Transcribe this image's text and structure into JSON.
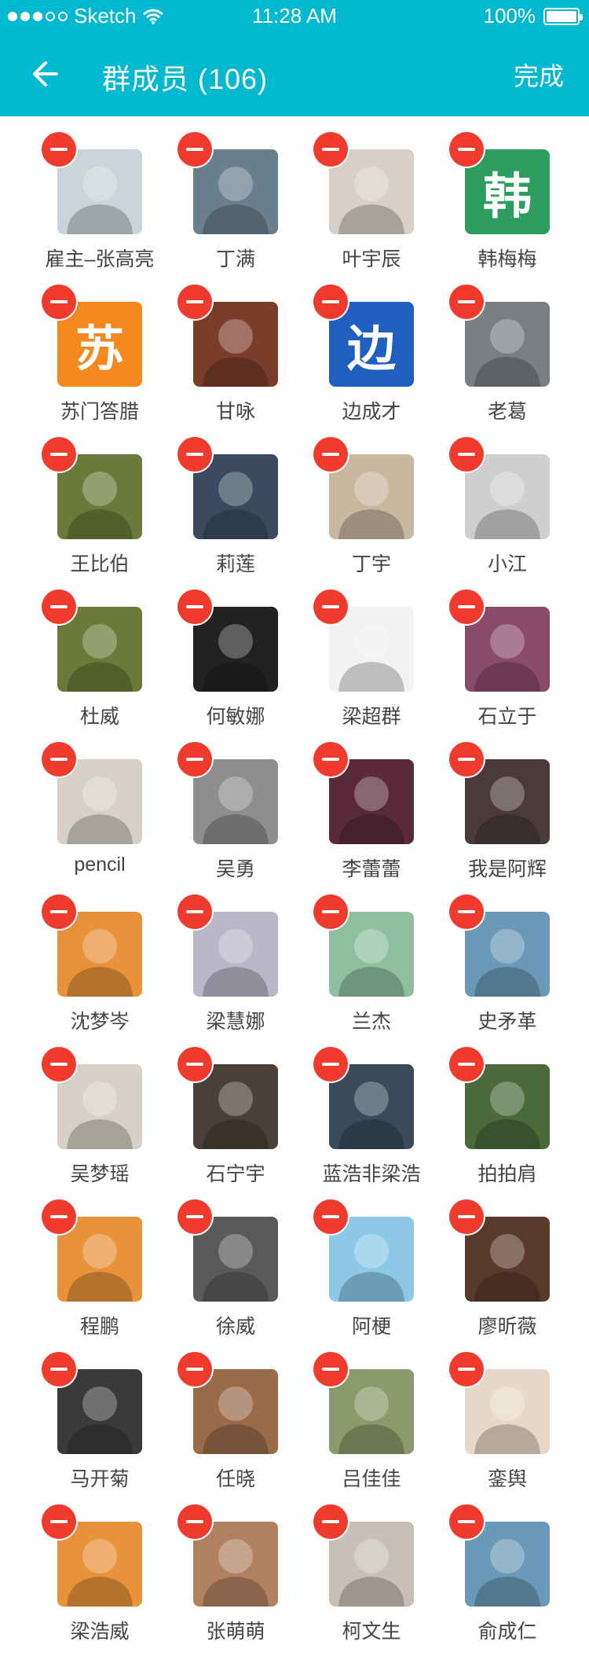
{
  "status_bar": {
    "carrier": "Sketch",
    "time": "11:28 AM",
    "battery": "100%"
  },
  "nav": {
    "title": "群成员 (106)",
    "done_label": "完成"
  },
  "icons": {
    "back": "back-arrow-icon",
    "remove": "remove-member-icon",
    "wifi": "wifi-icon",
    "battery": "battery-icon"
  },
  "members": [
    {
      "name": "雇主–张高亮",
      "color": "#c9d5d8",
      "avatar_type": "photo"
    },
    {
      "name": "丁满",
      "color": "#6a7f8c",
      "avatar_type": "photo"
    },
    {
      "name": "叶宇辰",
      "color": "#d8d0c8",
      "avatar_type": "photo"
    },
    {
      "name": "韩梅梅",
      "color": "#2e9e60",
      "avatar_type": "char",
      "char": "韩"
    },
    {
      "name": "苏门答腊",
      "color": "#f48a1e",
      "avatar_type": "char",
      "char": "苏"
    },
    {
      "name": "甘咏",
      "color": "#7a3d2a",
      "avatar_type": "photo"
    },
    {
      "name": "边成才",
      "color": "#1f5fbf",
      "avatar_type": "char",
      "char": "边"
    },
    {
      "name": "老葛",
      "color": "#7a7e82",
      "avatar_type": "photo"
    },
    {
      "name": "王比伯",
      "color": "#6b7a3a",
      "avatar_type": "photo"
    },
    {
      "name": "莉莲",
      "color": "#3b4a5e",
      "avatar_type": "photo"
    },
    {
      "name": "丁宇",
      "color": "#c8b8a0",
      "avatar_type": "photo"
    },
    {
      "name": "小江",
      "color": "#cfcfcf",
      "avatar_type": "photo"
    },
    {
      "name": "杜威",
      "color": "#6b7a3a",
      "avatar_type": "photo"
    },
    {
      "name": "何敏娜",
      "color": "#222222",
      "avatar_type": "photo"
    },
    {
      "name": "梁超群",
      "color": "#f2f2f2",
      "avatar_type": "photo"
    },
    {
      "name": "石立于",
      "color": "#8a4a6a",
      "avatar_type": "photo"
    },
    {
      "name": "pencil",
      "color": "#d7d0c6",
      "avatar_type": "photo"
    },
    {
      "name": "吴勇",
      "color": "#8e8e8e",
      "avatar_type": "photo"
    },
    {
      "name": "李蕾蕾",
      "color": "#5a2a3a",
      "avatar_type": "photo"
    },
    {
      "name": "我是阿辉",
      "color": "#4a3a3a",
      "avatar_type": "photo"
    },
    {
      "name": "沈梦岑",
      "color": "#e8923a",
      "avatar_type": "photo"
    },
    {
      "name": "梁慧娜",
      "color": "#b8b8c8",
      "avatar_type": "photo"
    },
    {
      "name": "兰杰",
      "color": "#8ec0a0",
      "avatar_type": "photo"
    },
    {
      "name": "史矛革",
      "color": "#6a9ab8",
      "avatar_type": "photo"
    },
    {
      "name": "吴梦瑶",
      "color": "#d7d0c6",
      "avatar_type": "photo"
    },
    {
      "name": "石宁宇",
      "color": "#4a4038",
      "avatar_type": "photo"
    },
    {
      "name": "蓝浩非梁浩",
      "color": "#3a4a5a",
      "avatar_type": "photo"
    },
    {
      "name": "拍拍肩",
      "color": "#4a6a3a",
      "avatar_type": "photo"
    },
    {
      "name": "程鹏",
      "color": "#e8923a",
      "avatar_type": "photo"
    },
    {
      "name": "徐威",
      "color": "#5a5a5a",
      "avatar_type": "photo"
    },
    {
      "name": "阿梗",
      "color": "#8ec8e8",
      "avatar_type": "photo"
    },
    {
      "name": "廖昕薇",
      "color": "#5a3a2a",
      "avatar_type": "photo"
    },
    {
      "name": "马开菊",
      "color": "#3a3a3a",
      "avatar_type": "photo"
    },
    {
      "name": "任晓",
      "color": "#9a6a4a",
      "avatar_type": "photo"
    },
    {
      "name": "吕佳佳",
      "color": "#8a9a6a",
      "avatar_type": "photo"
    },
    {
      "name": "銮舆",
      "color": "#e8d8c8",
      "avatar_type": "photo"
    },
    {
      "name": "梁浩威",
      "color": "#e8923a",
      "avatar_type": "photo"
    },
    {
      "name": "张萌萌",
      "color": "#b08060",
      "avatar_type": "photo"
    },
    {
      "name": "柯文生",
      "color": "#c8c0b8",
      "avatar_type": "photo"
    },
    {
      "name": "俞成仁",
      "color": "#6a9ab8",
      "avatar_type": "photo"
    }
  ]
}
